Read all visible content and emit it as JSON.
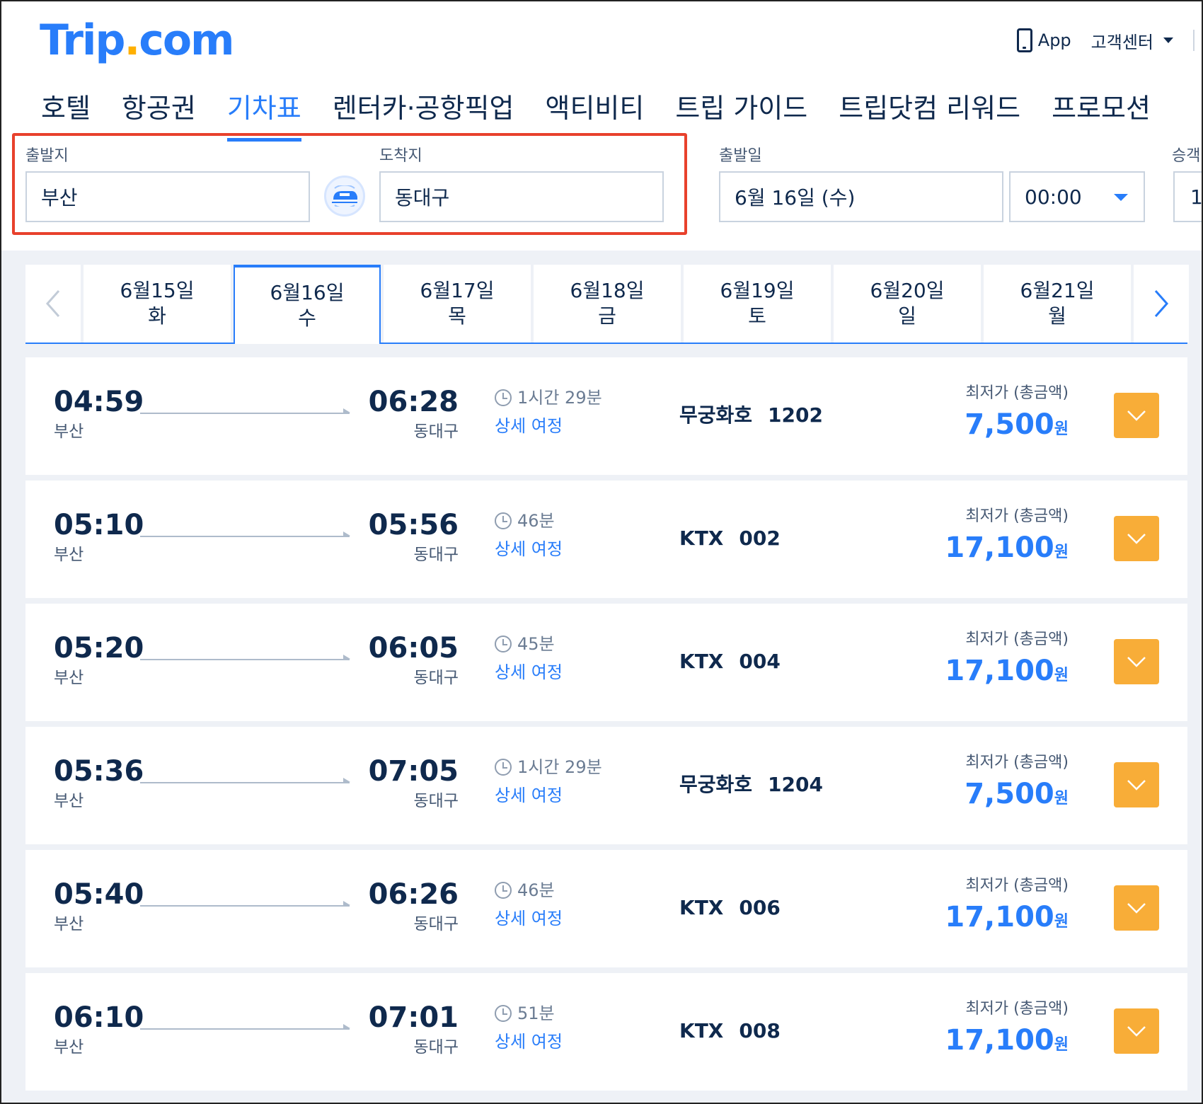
{
  "header": {
    "logo_main": "Trip",
    "logo_dot": ".",
    "logo_tld": "com",
    "app_label": "App",
    "support_label": "고객센터"
  },
  "nav": {
    "items": [
      {
        "label": "호텔"
      },
      {
        "label": "항공권"
      },
      {
        "label": "기차표",
        "active": true
      },
      {
        "label": "렌터카·공항픽업"
      },
      {
        "label": "액티비티"
      },
      {
        "label": "트립 가이드"
      },
      {
        "label": "트립닷컴 리워드"
      },
      {
        "label": "프로모션"
      }
    ]
  },
  "search": {
    "departure_label": "출발지",
    "departure_value": "부산",
    "arrival_label": "도착지",
    "arrival_value": "동대구",
    "date_label": "출발일",
    "date_value": "6월 16일 (수)",
    "time_value": "00:00",
    "passengers_label": "승객",
    "passengers_value": "1"
  },
  "dates": [
    {
      "date": "6월15일",
      "weekday": "화"
    },
    {
      "date": "6월16일",
      "weekday": "수",
      "active": true
    },
    {
      "date": "6월17일",
      "weekday": "목"
    },
    {
      "date": "6월18일",
      "weekday": "금"
    },
    {
      "date": "6월19일",
      "weekday": "토"
    },
    {
      "date": "6월20일",
      "weekday": "일"
    },
    {
      "date": "6월21일",
      "weekday": "월"
    }
  ],
  "results": {
    "details_label": "상세 여정",
    "price_label": "최저가 (총금액)",
    "currency_unit": "원",
    "trains": [
      {
        "dep_time": "04:59",
        "dep_station": "부산",
        "arr_time": "06:28",
        "arr_station": "동대구",
        "duration": "1시간 29분",
        "type": "무궁화호",
        "number": "1202",
        "price": "7,500"
      },
      {
        "dep_time": "05:10",
        "dep_station": "부산",
        "arr_time": "05:56",
        "arr_station": "동대구",
        "duration": "46분",
        "type": "KTX",
        "number": "002",
        "price": "17,100"
      },
      {
        "dep_time": "05:20",
        "dep_station": "부산",
        "arr_time": "06:05",
        "arr_station": "동대구",
        "duration": "45분",
        "type": "KTX",
        "number": "004",
        "price": "17,100"
      },
      {
        "dep_time": "05:36",
        "dep_station": "부산",
        "arr_time": "07:05",
        "arr_station": "동대구",
        "duration": "1시간 29분",
        "type": "무궁화호",
        "number": "1204",
        "price": "7,500"
      },
      {
        "dep_time": "05:40",
        "dep_station": "부산",
        "arr_time": "06:26",
        "arr_station": "동대구",
        "duration": "46분",
        "type": "KTX",
        "number": "006",
        "price": "17,100"
      },
      {
        "dep_time": "06:10",
        "dep_station": "부산",
        "arr_time": "07:01",
        "arr_station": "동대구",
        "duration": "51분",
        "type": "KTX",
        "number": "008",
        "price": "17,100"
      }
    ]
  },
  "colors": {
    "brand_blue": "#287dfa",
    "brand_yellow": "#ffb000",
    "highlight_red": "#e8412c",
    "expand_orange": "#f8ad38"
  }
}
